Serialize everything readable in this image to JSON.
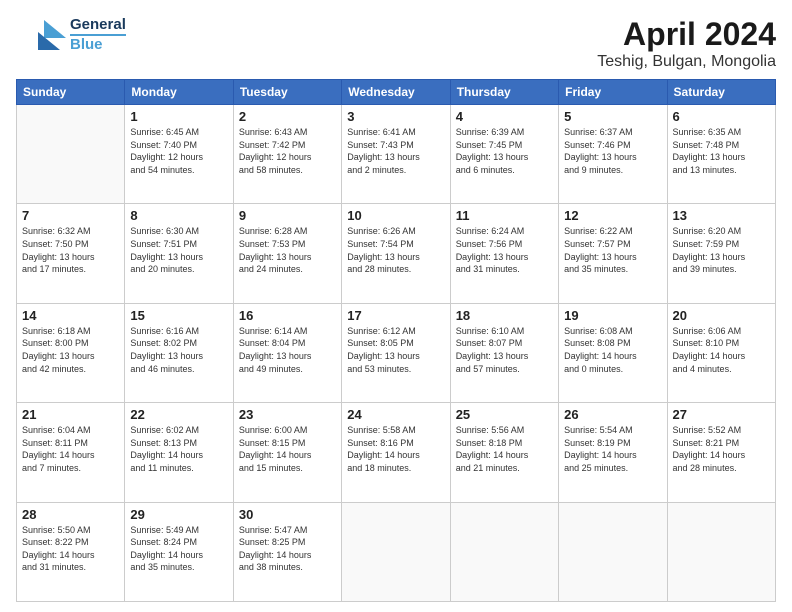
{
  "header": {
    "logo_line1": "General",
    "logo_line2": "Blue",
    "title": "April 2024",
    "subtitle": "Teshig, Bulgan, Mongolia"
  },
  "days_of_week": [
    "Sunday",
    "Monday",
    "Tuesday",
    "Wednesday",
    "Thursday",
    "Friday",
    "Saturday"
  ],
  "weeks": [
    [
      {
        "day": "",
        "info": ""
      },
      {
        "day": "1",
        "info": "Sunrise: 6:45 AM\nSunset: 7:40 PM\nDaylight: 12 hours\nand 54 minutes."
      },
      {
        "day": "2",
        "info": "Sunrise: 6:43 AM\nSunset: 7:42 PM\nDaylight: 12 hours\nand 58 minutes."
      },
      {
        "day": "3",
        "info": "Sunrise: 6:41 AM\nSunset: 7:43 PM\nDaylight: 13 hours\nand 2 minutes."
      },
      {
        "day": "4",
        "info": "Sunrise: 6:39 AM\nSunset: 7:45 PM\nDaylight: 13 hours\nand 6 minutes."
      },
      {
        "day": "5",
        "info": "Sunrise: 6:37 AM\nSunset: 7:46 PM\nDaylight: 13 hours\nand 9 minutes."
      },
      {
        "day": "6",
        "info": "Sunrise: 6:35 AM\nSunset: 7:48 PM\nDaylight: 13 hours\nand 13 minutes."
      }
    ],
    [
      {
        "day": "7",
        "info": "Sunrise: 6:32 AM\nSunset: 7:50 PM\nDaylight: 13 hours\nand 17 minutes."
      },
      {
        "day": "8",
        "info": "Sunrise: 6:30 AM\nSunset: 7:51 PM\nDaylight: 13 hours\nand 20 minutes."
      },
      {
        "day": "9",
        "info": "Sunrise: 6:28 AM\nSunset: 7:53 PM\nDaylight: 13 hours\nand 24 minutes."
      },
      {
        "day": "10",
        "info": "Sunrise: 6:26 AM\nSunset: 7:54 PM\nDaylight: 13 hours\nand 28 minutes."
      },
      {
        "day": "11",
        "info": "Sunrise: 6:24 AM\nSunset: 7:56 PM\nDaylight: 13 hours\nand 31 minutes."
      },
      {
        "day": "12",
        "info": "Sunrise: 6:22 AM\nSunset: 7:57 PM\nDaylight: 13 hours\nand 35 minutes."
      },
      {
        "day": "13",
        "info": "Sunrise: 6:20 AM\nSunset: 7:59 PM\nDaylight: 13 hours\nand 39 minutes."
      }
    ],
    [
      {
        "day": "14",
        "info": "Sunrise: 6:18 AM\nSunset: 8:00 PM\nDaylight: 13 hours\nand 42 minutes."
      },
      {
        "day": "15",
        "info": "Sunrise: 6:16 AM\nSunset: 8:02 PM\nDaylight: 13 hours\nand 46 minutes."
      },
      {
        "day": "16",
        "info": "Sunrise: 6:14 AM\nSunset: 8:04 PM\nDaylight: 13 hours\nand 49 minutes."
      },
      {
        "day": "17",
        "info": "Sunrise: 6:12 AM\nSunset: 8:05 PM\nDaylight: 13 hours\nand 53 minutes."
      },
      {
        "day": "18",
        "info": "Sunrise: 6:10 AM\nSunset: 8:07 PM\nDaylight: 13 hours\nand 57 minutes."
      },
      {
        "day": "19",
        "info": "Sunrise: 6:08 AM\nSunset: 8:08 PM\nDaylight: 14 hours\nand 0 minutes."
      },
      {
        "day": "20",
        "info": "Sunrise: 6:06 AM\nSunset: 8:10 PM\nDaylight: 14 hours\nand 4 minutes."
      }
    ],
    [
      {
        "day": "21",
        "info": "Sunrise: 6:04 AM\nSunset: 8:11 PM\nDaylight: 14 hours\nand 7 minutes."
      },
      {
        "day": "22",
        "info": "Sunrise: 6:02 AM\nSunset: 8:13 PM\nDaylight: 14 hours\nand 11 minutes."
      },
      {
        "day": "23",
        "info": "Sunrise: 6:00 AM\nSunset: 8:15 PM\nDaylight: 14 hours\nand 15 minutes."
      },
      {
        "day": "24",
        "info": "Sunrise: 5:58 AM\nSunset: 8:16 PM\nDaylight: 14 hours\nand 18 minutes."
      },
      {
        "day": "25",
        "info": "Sunrise: 5:56 AM\nSunset: 8:18 PM\nDaylight: 14 hours\nand 21 minutes."
      },
      {
        "day": "26",
        "info": "Sunrise: 5:54 AM\nSunset: 8:19 PM\nDaylight: 14 hours\nand 25 minutes."
      },
      {
        "day": "27",
        "info": "Sunrise: 5:52 AM\nSunset: 8:21 PM\nDaylight: 14 hours\nand 28 minutes."
      }
    ],
    [
      {
        "day": "28",
        "info": "Sunrise: 5:50 AM\nSunset: 8:22 PM\nDaylight: 14 hours\nand 31 minutes."
      },
      {
        "day": "29",
        "info": "Sunrise: 5:49 AM\nSunset: 8:24 PM\nDaylight: 14 hours\nand 35 minutes."
      },
      {
        "day": "30",
        "info": "Sunrise: 5:47 AM\nSunset: 8:25 PM\nDaylight: 14 hours\nand 38 minutes."
      },
      {
        "day": "",
        "info": ""
      },
      {
        "day": "",
        "info": ""
      },
      {
        "day": "",
        "info": ""
      },
      {
        "day": "",
        "info": ""
      }
    ]
  ]
}
